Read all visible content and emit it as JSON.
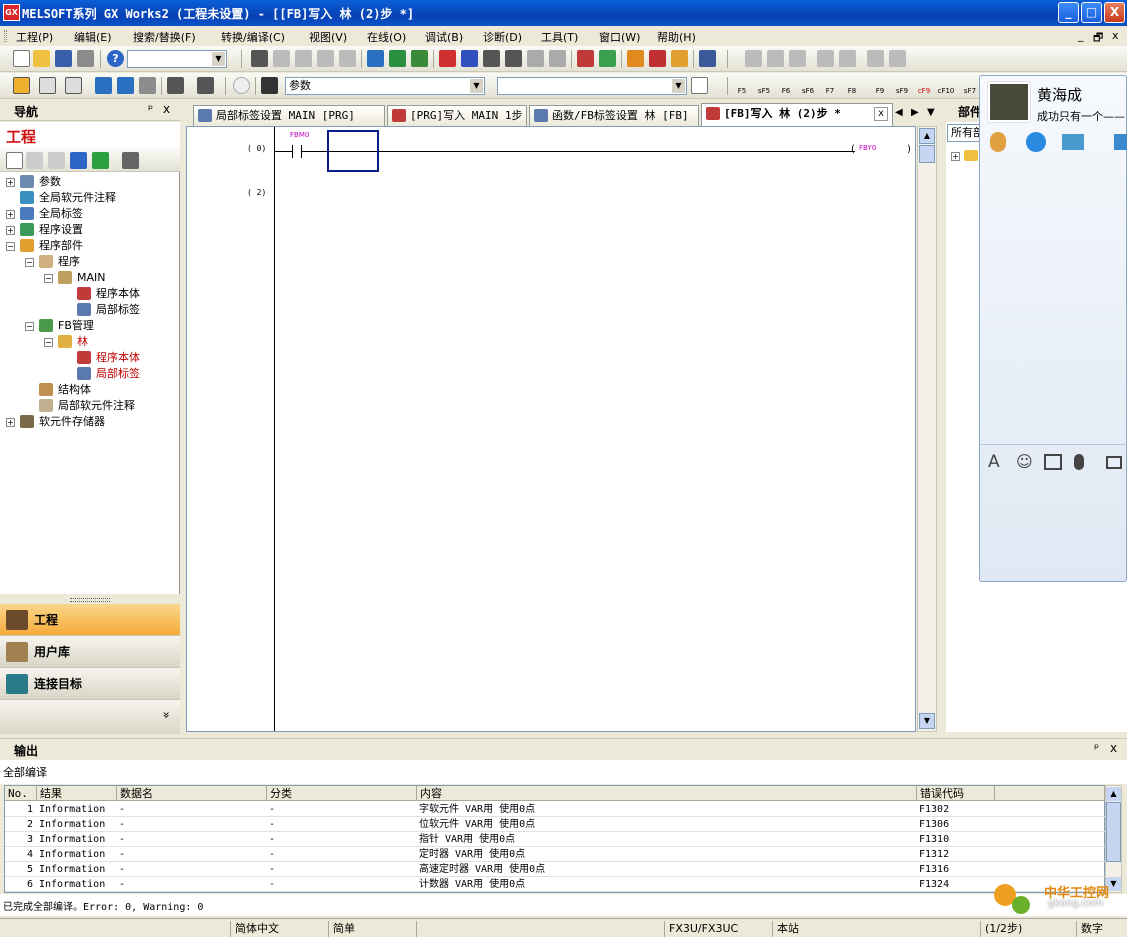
{
  "window": {
    "title": "MELSOFT系列 GX Works2 (工程未设置) - [[FB]写入 林 (2)步 *]",
    "logo_text": "GX",
    "min_label": "_",
    "max_label": "□",
    "close_label": "X"
  },
  "menu": {
    "items": [
      "工程(P)",
      "编辑(E)",
      "搜索/替换(F)",
      "转换/编译(C)",
      "视图(V)",
      "在线(O)",
      "调试(B)",
      "诊断(D)",
      "工具(T)",
      "窗口(W)",
      "帮助(H)"
    ],
    "mdi_controls": [
      "_",
      "🗗",
      "x"
    ]
  },
  "toolbar": {
    "combo_empty": "",
    "combo_param": "参数",
    "fkeys": [
      "F5",
      "sF5",
      "F6",
      "sF6",
      "F7",
      "F8",
      "F9",
      "sF9",
      "cF9",
      "cF10",
      "sF7"
    ]
  },
  "nav": {
    "header": "导航",
    "pin": "ᵖ",
    "close": "x",
    "title": "工程",
    "tree": [
      {
        "label": "参数",
        "level": 0,
        "pm": "+",
        "color": "#000"
      },
      {
        "label": "全局软元件注释",
        "level": 0,
        "pm": "",
        "color": "#000"
      },
      {
        "label": "全局标签",
        "level": 0,
        "pm": "+",
        "color": "#000"
      },
      {
        "label": "程序设置",
        "level": 0,
        "pm": "+",
        "color": "#000"
      },
      {
        "label": "程序部件",
        "level": 0,
        "pm": "−",
        "color": "#000"
      },
      {
        "label": "程序",
        "level": 1,
        "pm": "−",
        "color": "#000"
      },
      {
        "label": "MAIN",
        "level": 2,
        "pm": "−",
        "color": "#000"
      },
      {
        "label": "程序本体",
        "level": 3,
        "pm": "",
        "color": "#000"
      },
      {
        "label": "局部标签",
        "level": 3,
        "pm": "",
        "color": "#000"
      },
      {
        "label": "FB管理",
        "level": 1,
        "pm": "−",
        "color": "#000"
      },
      {
        "label": "林",
        "level": 2,
        "pm": "−",
        "color": "#c00000"
      },
      {
        "label": "程序本体",
        "level": 3,
        "pm": "",
        "color": "#c00000"
      },
      {
        "label": "局部标签",
        "level": 3,
        "pm": "",
        "color": "#c00000"
      },
      {
        "label": "结构体",
        "level": 1,
        "pm": "",
        "color": "#000"
      },
      {
        "label": "局部软元件注释",
        "level": 1,
        "pm": "",
        "color": "#000"
      },
      {
        "label": "软元件存储器",
        "level": 0,
        "pm": "+",
        "color": "#000"
      }
    ],
    "buttons": [
      "工程",
      "用户库",
      "连接目标"
    ],
    "more": "»"
  },
  "tabs": [
    {
      "label": "局部标签设置 MAIN [PRG]",
      "active": false
    },
    {
      "label": "[PRG]写入 MAIN 1步",
      "active": false
    },
    {
      "label": "函数/FB标签设置 林 [FB]",
      "active": false
    },
    {
      "label": "[FB]写入 林 (2)步 *",
      "active": true
    }
  ],
  "tab_close": "x",
  "ladder": {
    "rows": [
      {
        "step": "(  0)"
      },
      {
        "step": "(  2)"
      }
    ],
    "contact_label": "FBM0",
    "coil_label": "FBY0"
  },
  "right_panel": {
    "header": "部件",
    "combo": "所有部",
    "tree_pm": "+"
  },
  "chat": {
    "name": "黄海成",
    "message": "成功只有一个——"
  },
  "output": {
    "header": "输出",
    "pin": "ᵖ",
    "close": "x",
    "subtitle": "全部编译",
    "columns": [
      "No.",
      "结果",
      "数据名",
      "分类",
      "内容",
      "错误代码"
    ],
    "rows": [
      {
        "no": "1",
        "result": "Information",
        "data": "-",
        "cat": "-",
        "content": "字软元件 VAR用 使用0点",
        "code": "F1302"
      },
      {
        "no": "2",
        "result": "Information",
        "data": "-",
        "cat": "-",
        "content": "位软元件 VAR用 使用0点",
        "code": "F1306"
      },
      {
        "no": "3",
        "result": "Information",
        "data": "-",
        "cat": "-",
        "content": "指针 VAR用 使用0点",
        "code": "F1310"
      },
      {
        "no": "4",
        "result": "Information",
        "data": "-",
        "cat": "-",
        "content": "定时器 VAR用 使用0点",
        "code": "F1312"
      },
      {
        "no": "5",
        "result": "Information",
        "data": "-",
        "cat": "-",
        "content": "高速定时器 VAR用 使用0点",
        "code": "F1316"
      },
      {
        "no": "6",
        "result": "Information",
        "data": "-",
        "cat": "-",
        "content": "计数器 VAR用 使用0点",
        "code": "F1324"
      }
    ],
    "status_message": "已完成全部编译。Error: 0, Warning: 0"
  },
  "statusbar": {
    "cells": [
      "简体中文",
      "简单",
      "FX3U/FX3UC",
      "本站",
      "(1/2步)",
      "数字"
    ]
  },
  "watermark": {
    "brand": "中华工控网",
    "url": "gkong.com"
  }
}
